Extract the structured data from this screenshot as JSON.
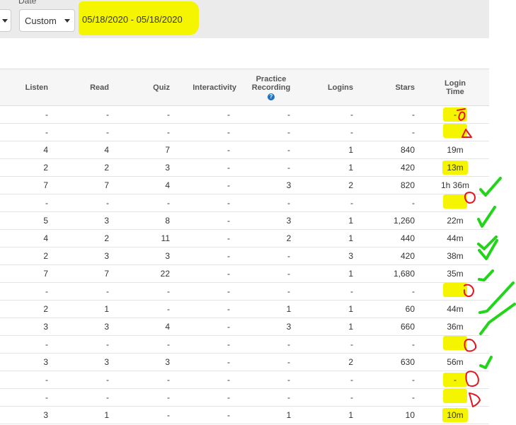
{
  "filters": {
    "date_label": "Date",
    "range_value": "Custom",
    "date_range": "05/18/2020 - 05/18/2020"
  },
  "table": {
    "headers": {
      "listen": "Listen",
      "read": "Read",
      "quiz": "Quiz",
      "interactivity": "Interactivity",
      "practice_line1": "Practice",
      "practice_line2": "Recording",
      "logins": "Logins",
      "stars": "Stars",
      "login_time_line1": "Login",
      "login_time_line2": "Time"
    },
    "rows": [
      {
        "listen": "-",
        "read": "-",
        "quiz": "-",
        "interactivity": "-",
        "practice": "-",
        "logins": "-",
        "stars": "-",
        "time": "-"
      },
      {
        "listen": "-",
        "read": "-",
        "quiz": "-",
        "interactivity": "-",
        "practice": "-",
        "logins": "-",
        "stars": "-",
        "time": ""
      },
      {
        "listen": "4",
        "read": "4",
        "quiz": "7",
        "interactivity": "-",
        "practice": "-",
        "logins": "1",
        "stars": "840",
        "time": "19m"
      },
      {
        "listen": "2",
        "read": "2",
        "quiz": "3",
        "interactivity": "-",
        "practice": "-",
        "logins": "1",
        "stars": "420",
        "time": "13m"
      },
      {
        "listen": "7",
        "read": "7",
        "quiz": "4",
        "interactivity": "-",
        "practice": "3",
        "logins": "2",
        "stars": "820",
        "time": "1h 36m"
      },
      {
        "listen": "-",
        "read": "-",
        "quiz": "-",
        "interactivity": "-",
        "practice": "-",
        "logins": "-",
        "stars": "-",
        "time": ""
      },
      {
        "listen": "5",
        "read": "3",
        "quiz": "8",
        "interactivity": "-",
        "practice": "3",
        "logins": "1",
        "stars": "1,260",
        "time": "22m"
      },
      {
        "listen": "4",
        "read": "2",
        "quiz": "11",
        "interactivity": "-",
        "practice": "2",
        "logins": "1",
        "stars": "440",
        "time": "44m"
      },
      {
        "listen": "2",
        "read": "3",
        "quiz": "3",
        "interactivity": "-",
        "practice": "-",
        "logins": "3",
        "stars": "420",
        "time": "38m"
      },
      {
        "listen": "7",
        "read": "7",
        "quiz": "22",
        "interactivity": "-",
        "practice": "-",
        "logins": "1",
        "stars": "1,680",
        "time": "35m"
      },
      {
        "listen": "-",
        "read": "-",
        "quiz": "-",
        "interactivity": "-",
        "practice": "-",
        "logins": "-",
        "stars": "-",
        "time": ""
      },
      {
        "listen": "2",
        "read": "1",
        "quiz": "-",
        "interactivity": "-",
        "practice": "1",
        "logins": "1",
        "stars": "60",
        "time": "44m"
      },
      {
        "listen": "3",
        "read": "3",
        "quiz": "4",
        "interactivity": "-",
        "practice": "3",
        "logins": "1",
        "stars": "660",
        "time": "36m"
      },
      {
        "listen": "-",
        "read": "-",
        "quiz": "-",
        "interactivity": "-",
        "practice": "-",
        "logins": "-",
        "stars": "-",
        "time": ""
      },
      {
        "listen": "3",
        "read": "3",
        "quiz": "3",
        "interactivity": "-",
        "practice": "-",
        "logins": "2",
        "stars": "630",
        "time": "56m"
      },
      {
        "listen": "-",
        "read": "-",
        "quiz": "-",
        "interactivity": "-",
        "practice": "-",
        "logins": "-",
        "stars": "-",
        "time": "-"
      },
      {
        "listen": "-",
        "read": "-",
        "quiz": "-",
        "interactivity": "-",
        "practice": "-",
        "logins": "-",
        "stars": "-",
        "time": ""
      },
      {
        "listen": "3",
        "read": "1",
        "quiz": "-",
        "interactivity": "-",
        "practice": "1",
        "logins": "1",
        "stars": "10",
        "time": "10m"
      }
    ]
  },
  "annotations": {
    "highlight_color": "#f5f500",
    "red_mark_color": "#e8141e",
    "green_check_color": "#22d41a",
    "highlighted_time_rows": [
      0,
      1,
      3,
      5,
      10,
      13,
      15,
      16,
      17
    ],
    "checked_rows": [
      4,
      6,
      7,
      8,
      9,
      11,
      12,
      14
    ]
  }
}
